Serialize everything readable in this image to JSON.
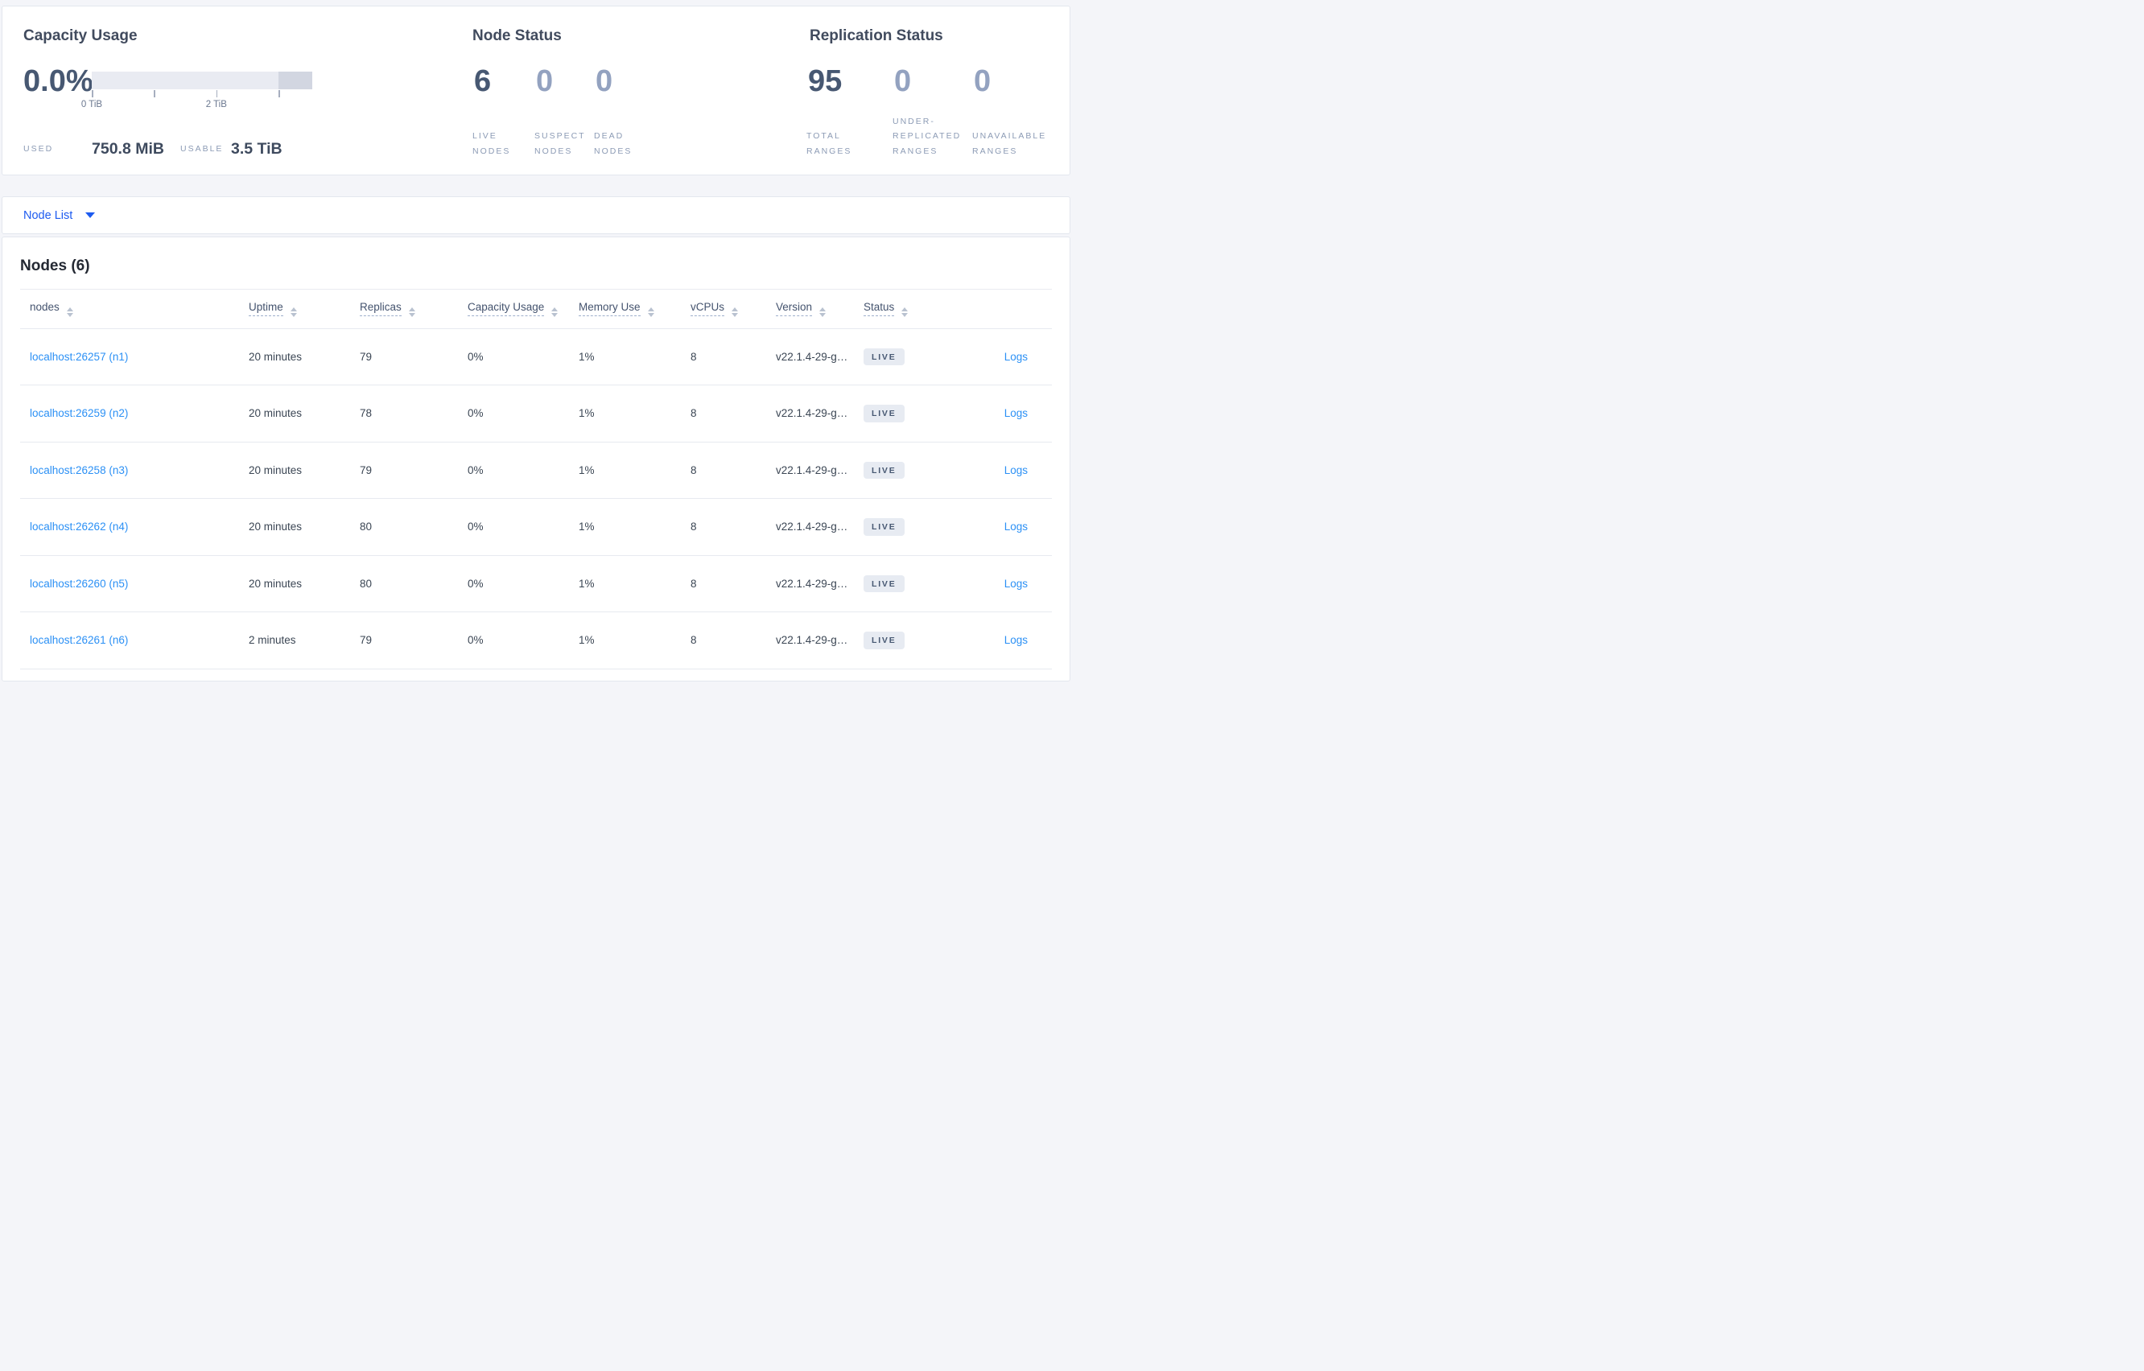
{
  "colors": {
    "page-bg": "#f4f5f9",
    "primary-link": "#1d5bf0",
    "table-link": "#2b90f5",
    "number": "#475872",
    "number-muted": "#93a2c0",
    "badge-bg": "#e7ebf2",
    "badge-text": "#475872",
    "bar-track": "#e9ebf2",
    "bar-segment": "#d2d6e1"
  },
  "summary": {
    "capacity": {
      "title": "Capacity Usage",
      "percent": "0.0%",
      "ticks": [
        {
          "label": "0 TiB"
        },
        {
          "label": ""
        },
        {
          "label": "2 TiB"
        },
        {
          "label": ""
        }
      ],
      "used_label": "USED",
      "used_value": "750.8 MiB",
      "usable_label": "USABLE",
      "usable_value": "3.5 TiB"
    },
    "node_status": {
      "title": "Node Status",
      "stats": [
        {
          "value": "6",
          "label": "LIVE NODES"
        },
        {
          "value": "0",
          "label": "SUSPECT NODES"
        },
        {
          "value": "0",
          "label": "DEAD NODES"
        }
      ]
    },
    "replication": {
      "title": "Replication Status",
      "stats": [
        {
          "value": "95",
          "label": "TOTAL RANGES"
        },
        {
          "value": "0",
          "label": "UNDER-REPLICATED RANGES"
        },
        {
          "value": "0",
          "label": "UNAVAILABLE RANGES"
        }
      ]
    }
  },
  "node_list": {
    "label": "Node List"
  },
  "nodes_table": {
    "title": "Nodes (6)",
    "headers": {
      "nodes": "nodes",
      "uptime": "Uptime",
      "replicas": "Replicas",
      "capacity": "Capacity Usage",
      "memory": "Memory Use",
      "vcpus": "vCPUs",
      "version": "Version",
      "status": "Status"
    },
    "rows": [
      {
        "node": "localhost:26257 (n1)",
        "uptime": "20 minutes",
        "replicas": "79",
        "capacity": "0%",
        "memory": "1%",
        "vcpus": "8",
        "version": "v22.1.4-29-g…",
        "status": "LIVE",
        "logs": "Logs"
      },
      {
        "node": "localhost:26259 (n2)",
        "uptime": "20 minutes",
        "replicas": "78",
        "capacity": "0%",
        "memory": "1%",
        "vcpus": "8",
        "version": "v22.1.4-29-g…",
        "status": "LIVE",
        "logs": "Logs"
      },
      {
        "node": "localhost:26258 (n3)",
        "uptime": "20 minutes",
        "replicas": "79",
        "capacity": "0%",
        "memory": "1%",
        "vcpus": "8",
        "version": "v22.1.4-29-g…",
        "status": "LIVE",
        "logs": "Logs"
      },
      {
        "node": "localhost:26262 (n4)",
        "uptime": "20 minutes",
        "replicas": "80",
        "capacity": "0%",
        "memory": "1%",
        "vcpus": "8",
        "version": "v22.1.4-29-g…",
        "status": "LIVE",
        "logs": "Logs"
      },
      {
        "node": "localhost:26260 (n5)",
        "uptime": "20 minutes",
        "replicas": "80",
        "capacity": "0%",
        "memory": "1%",
        "vcpus": "8",
        "version": "v22.1.4-29-g…",
        "status": "LIVE",
        "logs": "Logs"
      },
      {
        "node": "localhost:26261 (n6)",
        "uptime": "2 minutes",
        "replicas": "79",
        "capacity": "0%",
        "memory": "1%",
        "vcpus": "8",
        "version": "v22.1.4-29-g…",
        "status": "LIVE",
        "logs": "Logs"
      }
    ]
  }
}
